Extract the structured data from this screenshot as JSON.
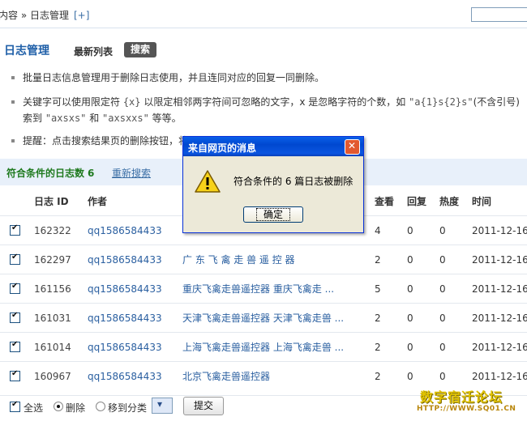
{
  "breadcrumb": {
    "text": "内容 » 日志管理",
    "add": "[+]"
  },
  "header": {
    "title": "日志管理",
    "tabs": [
      {
        "label": "最新列表"
      },
      {
        "label": "搜索",
        "active": true
      }
    ]
  },
  "tips": {
    "tip1": "批量日志信息管理用于删除日志使用，并且连同对应的回复一同删除。",
    "tip2_a": "关键字可以使用限定符 ",
    "tip2_code1": "{x}",
    "tip2_b": " 以限定相邻两字符间可忽略的文字，x 是忽略字符的个数，如 ",
    "tip2_code2": "\"a{1}s{2}s\"",
    "tip2_c": "(不含引号)",
    "tip2_line2_a": "索到 ",
    "tip2_code3": "\"axsxs\"",
    "tip2_line2_b": " 和 ",
    "tip2_code4": "\"axsxxs\"",
    "tip2_line2_c": " 等等。",
    "tip3": "提醒：点击搜索结果页的删除按钮，将"
  },
  "results": {
    "label": "符合条件的日志数",
    "count": "6",
    "research": "重新搜索"
  },
  "table": {
    "columns": {
      "id": "日志 ID",
      "author": "作者",
      "views": "查看",
      "replies": "回复",
      "heat": "热度",
      "time": "时间"
    },
    "rows": [
      {
        "id": "162322",
        "author": "qq1586584433",
        "title": "",
        "views": "4",
        "replies": "0",
        "heat": "0",
        "time": "2011-12-16"
      },
      {
        "id": "162297",
        "author": "qq1586584433",
        "title": "广 东 飞 禽 走 兽 遥 控 器",
        "views": "2",
        "replies": "0",
        "heat": "0",
        "time": "2011-12-16"
      },
      {
        "id": "161156",
        "author": "qq1586584433",
        "title": "重庆飞禽走兽遥控器 重庆飞禽走 ...",
        "views": "5",
        "replies": "0",
        "heat": "0",
        "time": "2011-12-16"
      },
      {
        "id": "161031",
        "author": "qq1586584433",
        "title": "天津飞禽走兽遥控器 天津飞禽走兽 ...",
        "views": "2",
        "replies": "0",
        "heat": "0",
        "time": "2011-12-16"
      },
      {
        "id": "161014",
        "author": "qq1586584433",
        "title": "上海飞禽走兽遥控器 上海飞禽走兽 ...",
        "views": "2",
        "replies": "0",
        "heat": "0",
        "time": "2011-12-16"
      },
      {
        "id": "160967",
        "author": "qq1586584433",
        "title": "北京飞禽走兽遥控器",
        "views": "2",
        "replies": "0",
        "heat": "0",
        "time": "2011-12-16"
      }
    ]
  },
  "bottom": {
    "select_all": "全选",
    "delete": "删除",
    "move": "移到分类",
    "submit": "提交"
  },
  "dialog": {
    "title": "来自网页的消息",
    "message": "符合条件的 6 篇日志被删除",
    "ok": "确定",
    "icon": "warning-icon"
  },
  "watermark": {
    "line1": "数字宿迁论坛",
    "line2": "HTTP://WWW.SQ01.CN"
  },
  "colors": {
    "accent": "#1f5fa8",
    "link": "#2a5fa0",
    "result_label": "#1f7a1f",
    "dialog_title": "#0a5fe8"
  }
}
